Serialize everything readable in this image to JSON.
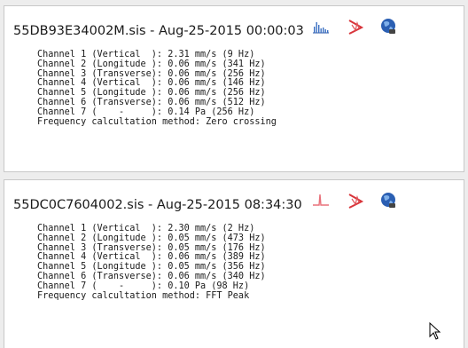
{
  "records": [
    {
      "title": "55DB93E34002M.sis - Aug-25-2015 00:00:03",
      "icons": [
        "bar-chart-icon",
        "waveform-icon",
        "globe-icon"
      ],
      "lines": [
        "Channel 1 (Vertical  ): 2.31 mm/s (9 Hz)",
        "Channel 2 (Longitude ): 0.06 mm/s (341 Hz)",
        "Channel 3 (Transverse): 0.06 mm/s (256 Hz)",
        "Channel 4 (Vertical  ): 0.06 mm/s (146 Hz)",
        "Channel 5 (Longitude ): 0.06 mm/s (256 Hz)",
        "Channel 6 (Transverse): 0.06 mm/s (512 Hz)",
        "Channel 7 (    -     ): 0.14 Pa (256 Hz)",
        "Frequency calcultation method: Zero crossing"
      ]
    },
    {
      "title": "55DC0C7604002.sis - Aug-25-2015 08:34:30",
      "icons": [
        "spectrum-icon",
        "waveform-icon",
        "globe-icon"
      ],
      "lines": [
        "Channel 1 (Vertical  ): 2.30 mm/s (2 Hz)",
        "Channel 2 (Longitude ): 0.05 mm/s (473 Hz)",
        "Channel 3 (Transverse): 0.05 mm/s (176 Hz)",
        "Channel 4 (Vertical  ): 0.06 mm/s (389 Hz)",
        "Channel 5 (Longitude ): 0.05 mm/s (356 Hz)",
        "Channel 6 (Transverse): 0.06 mm/s (340 Hz)",
        "Channel 7 (    -     ): 0.10 Pa (98 Hz)",
        "Frequency calcultation method: FFT Peak"
      ]
    }
  ]
}
